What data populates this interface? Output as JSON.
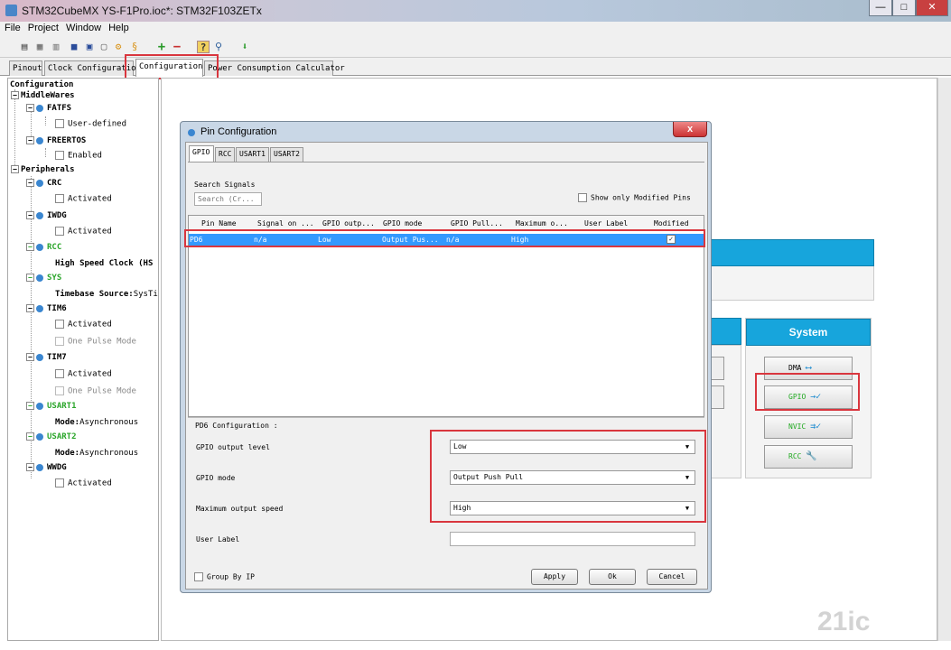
{
  "window": {
    "title": "STM32CubeMX YS-F1Pro.ioc*: STM32F103ZETx",
    "minimize": "—",
    "maximize": "□",
    "close": "✕"
  },
  "menu": [
    "File",
    "Project",
    "Window",
    "Help"
  ],
  "toolbar_icons": [
    "new-project-icon",
    "open-icon",
    "copy-icon",
    "save-icon",
    "save-as-icon",
    "close-project-icon",
    "generate-code-icon",
    "report-icon",
    "add-icon",
    "remove-icon",
    "help-icon",
    "search-icon",
    "download-icon"
  ],
  "tabs": [
    "Pinout",
    "Clock Configuration",
    "Configuration",
    "Power Consumption Calculator"
  ],
  "active_tab": "Configuration",
  "tree": {
    "root": "Configuration",
    "middlewares": "MiddleWares",
    "fatfs": "FATFS",
    "fatfs_opt": "User-defined",
    "freertos": "FREERTOS",
    "freertos_opt": "Enabled",
    "peripherals": "Peripherals",
    "crc": "CRC",
    "crc_opt": "Activated",
    "iwdg": "IWDG",
    "iwdg_opt": "Activated",
    "rcc": "RCC",
    "rcc_opt": "High Speed Clock (HS",
    "sys": "SYS",
    "sys_opt_key": "Timebase Source:",
    "sys_opt_val": "SysTi",
    "tim6": "TIM6",
    "tim6_opt1": "Activated",
    "tim6_opt2": "One Pulse Mode",
    "tim7": "TIM7",
    "tim7_opt1": "Activated",
    "tim7_opt2": "One Pulse Mode",
    "usart1": "USART1",
    "usart1_key": "Mode:",
    "usart1_val": "Asynchronous",
    "usart2": "USART2",
    "usart2_key": "Mode:",
    "usart2_val": "Asynchronous",
    "wwdg": "WWDG",
    "wwdg_opt": "Activated"
  },
  "system": {
    "header": "System",
    "dma": "DMA",
    "gpio": "GPIO",
    "nvic": "NVIC",
    "rcc": "RCC"
  },
  "dialog": {
    "title": "Pin Configuration",
    "close": "x",
    "tabs": [
      "GPIO",
      "RCC",
      "USART1",
      "USART2"
    ],
    "search_label": "Search Signals",
    "search_placeholder": "Search (Cr...",
    "show_modified": "Show only Modified Pins",
    "columns": [
      "Pin Name",
      "Signal on ...",
      "GPIO outp...",
      "GPIO mode",
      "GPIO Pull...",
      "Maximum o...",
      "User Label",
      "Modified"
    ],
    "row": {
      "pin": "PD6",
      "signal": "n/a",
      "output": "Low",
      "mode": "Output Pus...",
      "pull": "n/a",
      "speed": "High",
      "label": "",
      "modified": "✓"
    },
    "section_title": "PD6 Configuration :",
    "level_label": "GPIO output level",
    "level_value": "Low",
    "mode_label": "GPIO mode",
    "mode_value": "Output Push Pull",
    "speed_label": "Maximum output speed",
    "speed_value": "High",
    "user_label": "User Label",
    "user_value": "",
    "group_by_ip": "Group By IP",
    "apply": "Apply",
    "ok": "Ok",
    "cancel": "Cancel"
  },
  "watermark": "21ic"
}
